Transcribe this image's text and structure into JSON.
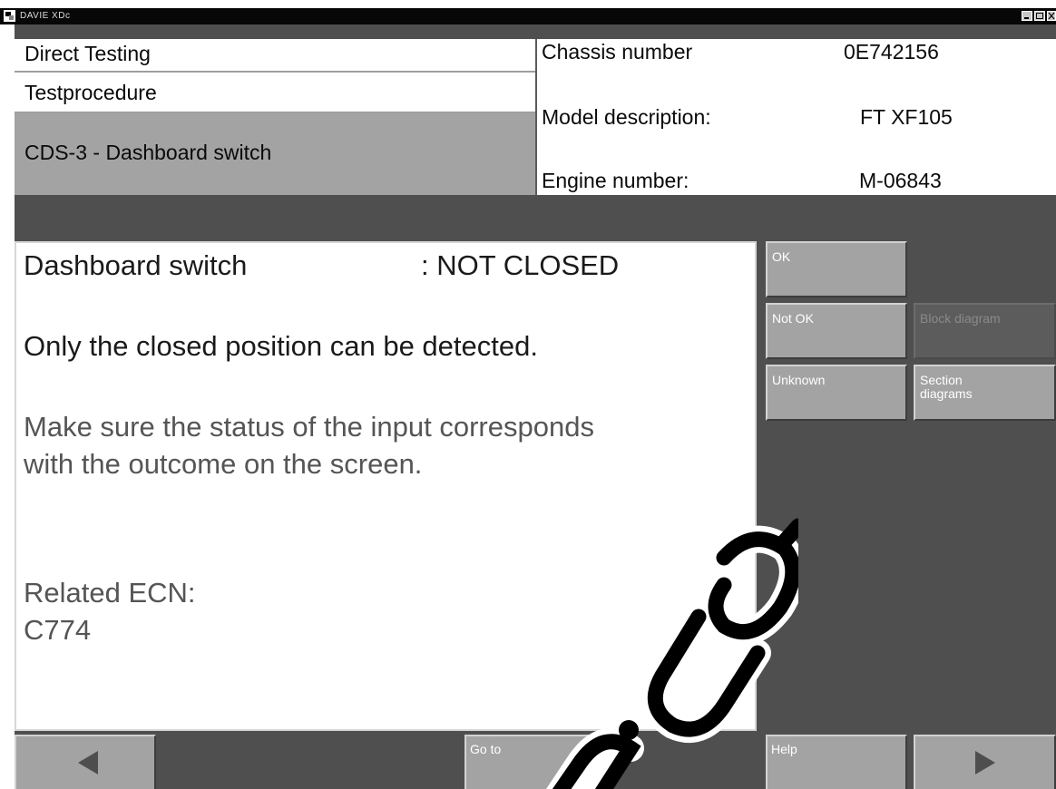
{
  "window": {
    "title": "DAVIE XDc"
  },
  "header": {
    "section": "Direct Testing",
    "subsection": "Testprocedure",
    "procedure": "CDS-3 - Dashboard switch",
    "vehicle": {
      "chassis_label": "Chassis number",
      "chassis_value": "0E742156",
      "model_label": "Model description:",
      "model_value": "FT XF105",
      "engine_label": "Engine number:",
      "engine_value": "M-06843"
    }
  },
  "message": {
    "status_label": "Dashboard switch",
    "status_value": ": NOT CLOSED",
    "note": "Only the closed position can be detected.",
    "instruction_line1": "Make sure the status of the input corresponds",
    "instruction_line2": "with the outcome on the screen.",
    "related_label": "Related ECN:",
    "related_value": "C774"
  },
  "side_buttons": {
    "ok": "OK",
    "not_ok": "Not OK",
    "block_diagram": "Block diagram",
    "unknown": "Unknown",
    "section_diagrams": "Section\ndiagrams"
  },
  "bottom_bar": {
    "go_to": "Go to",
    "help": "Help",
    "back_icon": "triangle-left",
    "forward_icon": "triangle-right"
  },
  "colors": {
    "screen_background": "#4f4f4f",
    "button_face": "#a3a3a3",
    "panel_background": "#ffffff",
    "title_bar": "#070707"
  }
}
